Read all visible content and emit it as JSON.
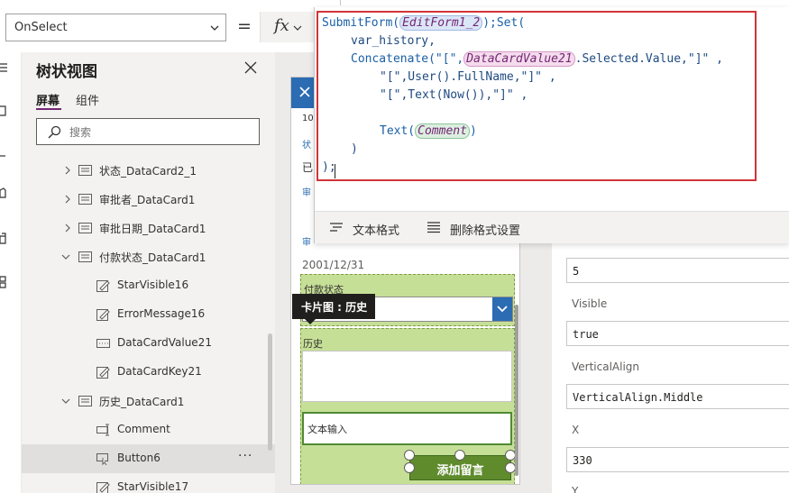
{
  "formula_bar": {
    "property": "OnSelect",
    "equals": "=",
    "fx": "fx"
  },
  "tree_view": {
    "title": "树状视图",
    "tabs": [
      {
        "label": "屏幕",
        "active": true
      },
      {
        "label": "组件",
        "active": false
      }
    ],
    "search_placeholder": "搜索",
    "items": [
      {
        "label": "状态_DataCard2_1",
        "icon": "card-icon",
        "expander": "chevron-right-icon",
        "level": 1
      },
      {
        "label": "审批者_DataCard1",
        "icon": "card-icon",
        "expander": "chevron-right-icon",
        "level": 1
      },
      {
        "label": "审批日期_DataCard1",
        "icon": "card-icon",
        "expander": "chevron-right-icon",
        "level": 1
      },
      {
        "label": "付款状态_DataCard1",
        "icon": "card-icon",
        "expander": "chevron-down-icon",
        "level": 1
      },
      {
        "label": "StarVisible16",
        "icon": "edit-label-icon",
        "level": 2
      },
      {
        "label": "ErrorMessage16",
        "icon": "edit-label-icon",
        "level": 2
      },
      {
        "label": "DataCardValue21",
        "icon": "dropdown-control-icon",
        "level": 2
      },
      {
        "label": "DataCardKey21",
        "icon": "edit-label-icon",
        "level": 2
      },
      {
        "label": "历史_DataCard1",
        "icon": "card-icon",
        "expander": "chevron-down-icon",
        "level": 1
      },
      {
        "label": "Comment",
        "icon": "text-input-icon",
        "level": 2
      },
      {
        "label": "Button6",
        "icon": "button-control-icon",
        "level": 2,
        "selected": true,
        "more": "···"
      },
      {
        "label": "StarVisible17",
        "icon": "edit-label-icon",
        "level": 2
      }
    ]
  },
  "canvas": {
    "partial_texts": [
      "10",
      "状",
      "已",
      "审",
      "审"
    ],
    "date_value": "2001/12/31",
    "payment_label": "付款状态",
    "tooltip": "卡片图 : 历史",
    "history_label": "历史",
    "comment_input": "文本输入",
    "add_button": "添加留言"
  },
  "properties": {
    "rows": [
      {
        "label": "",
        "value": "5"
      },
      {
        "label": "Visible",
        "value": "true"
      },
      {
        "label": "VerticalAlign",
        "value": "VerticalAlign.Middle"
      },
      {
        "label": "X",
        "value": "330"
      },
      {
        "label": "Y",
        "value": ""
      }
    ]
  },
  "editor": {
    "code": {
      "l1_fn1": "SubmitForm(",
      "l1_ref1": "EditForm1_2",
      "l1_rest": ");Set(",
      "l2": "var_history,",
      "l3_fn": "Concatenate(\"[\",",
      "l3_ref": "DataCardValue21",
      "l3_rest": ".Selected.Value,\"]\" ,",
      "l4": "\"[\",User().FullName,\"]\" ,",
      "l5": "\"[\",Text(Now()),\"]\" ,",
      "l6_fn": "Text(",
      "l6_ref": "Comment",
      "l6_rest": ")",
      "l7": ")",
      "l8": ");"
    },
    "format_text": "文本格式",
    "remove_format": "删除格式设置"
  },
  "colors": {
    "accent": "#742774",
    "brand_blue": "#2b6cb3",
    "card_green": "#c6df97",
    "button_green": "#5f8b2d",
    "highlight_red": "#d13438"
  }
}
